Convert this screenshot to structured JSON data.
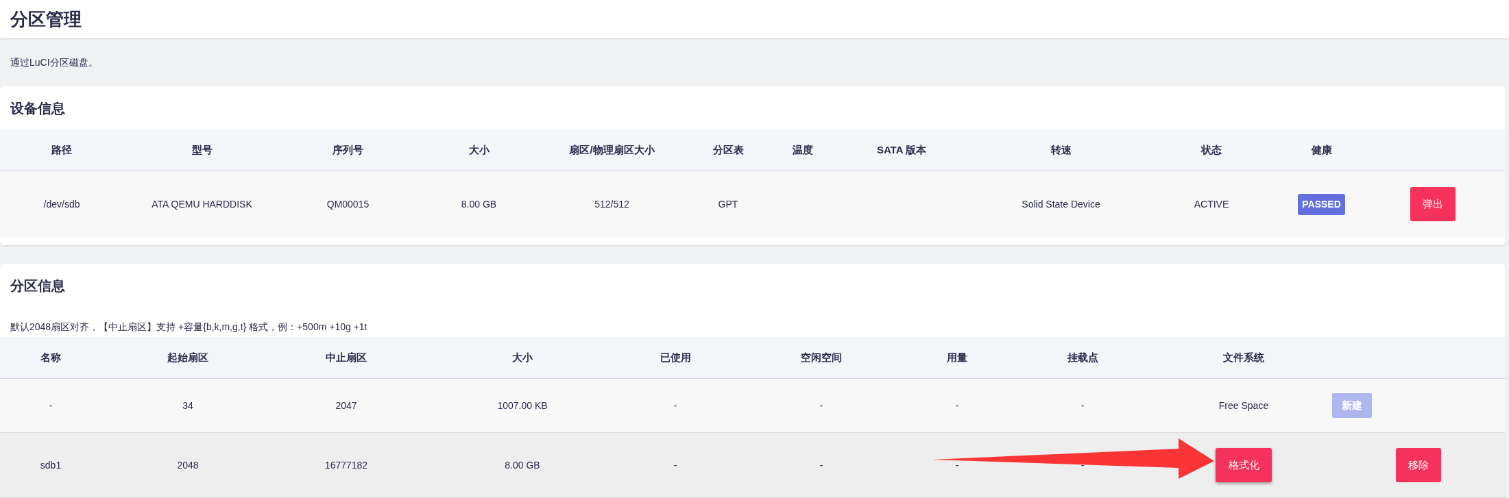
{
  "page": {
    "title": "分区管理",
    "description": "通过LuCI分区磁盘。"
  },
  "device_info": {
    "title": "设备信息",
    "columns": [
      "路径",
      "型号",
      "序列号",
      "大小",
      "扇区/物理扇区大小",
      "分区表",
      "温度",
      "SATA 版本",
      "转速",
      "状态",
      "健康"
    ],
    "rows": [
      {
        "cells": [
          "/dev/sdb",
          "ATA QEMU HARDDISK",
          "QM00015",
          "8.00 GB",
          "512/512",
          "GPT",
          "",
          "",
          "Solid State Device",
          "ACTIVE"
        ],
        "health": "PASSED",
        "action": "弹出"
      }
    ]
  },
  "partition_info": {
    "title": "分区信息",
    "note": "默认2048扇区对齐，【中止扇区】支持 +容量{b,k,m,g,t} 格式，例：+500m +10g +1t",
    "columns": [
      "名称",
      "起始扇区",
      "中止扇区",
      "大小",
      "已使用",
      "空闲空间",
      "用量",
      "挂载点",
      "文件系统"
    ],
    "rows": [
      {
        "kind": "free",
        "cells": [
          "-",
          "34",
          "2047",
          "1007.00 KB",
          "-",
          "-",
          "-",
          "-"
        ],
        "filesystem": "Free Space",
        "buttons": [
          {
            "label": "新建",
            "disabled": true
          }
        ]
      },
      {
        "kind": "partition",
        "cells": [
          "sdb1",
          "2048",
          "16777182",
          "8.00 GB",
          "-",
          "-",
          "-",
          "-"
        ],
        "filesystem": "格式化",
        "buttons": [
          {
            "label": "移除",
            "disabled": false
          }
        ],
        "annotated": true
      }
    ]
  }
}
